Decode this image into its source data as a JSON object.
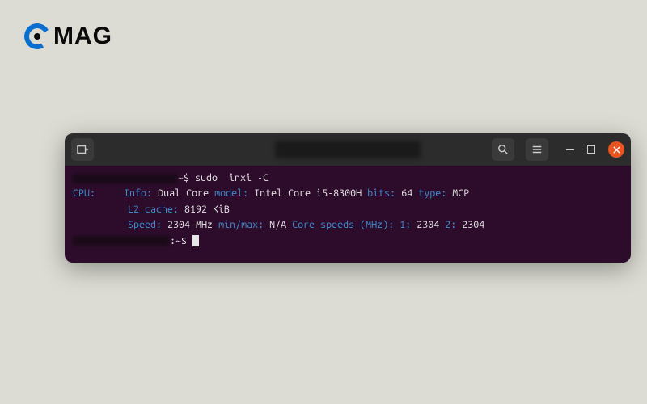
{
  "logo": {
    "text": "MAG"
  },
  "terminal": {
    "command": "sudo  inxi -C",
    "prompt_suffix": "~$",
    "prompt_suffix2": ":~$",
    "output": {
      "cpu_label": "CPU:",
      "info_label": "Info:",
      "info_value": "Dual Core",
      "model_label": "model:",
      "model_value": "Intel Core i5-8300H",
      "bits_label": "bits:",
      "bits_value": "64",
      "type_label": "type:",
      "type_value": "MCP",
      "l2_label": "L2 cache:",
      "l2_value": "8192 KiB",
      "speed_label": "Speed:",
      "speed_value": "2304 MHz",
      "minmax_label": "min/max:",
      "minmax_value": "N/A",
      "cores_label": "Core speeds (MHz):",
      "core1_label": "1:",
      "core1_value": "2304",
      "core2_label": "2:",
      "core2_value": "2304"
    }
  },
  "colors": {
    "accent": "#e95420",
    "term_bg": "#2d0c2b",
    "blue": "#3d8fd1"
  }
}
